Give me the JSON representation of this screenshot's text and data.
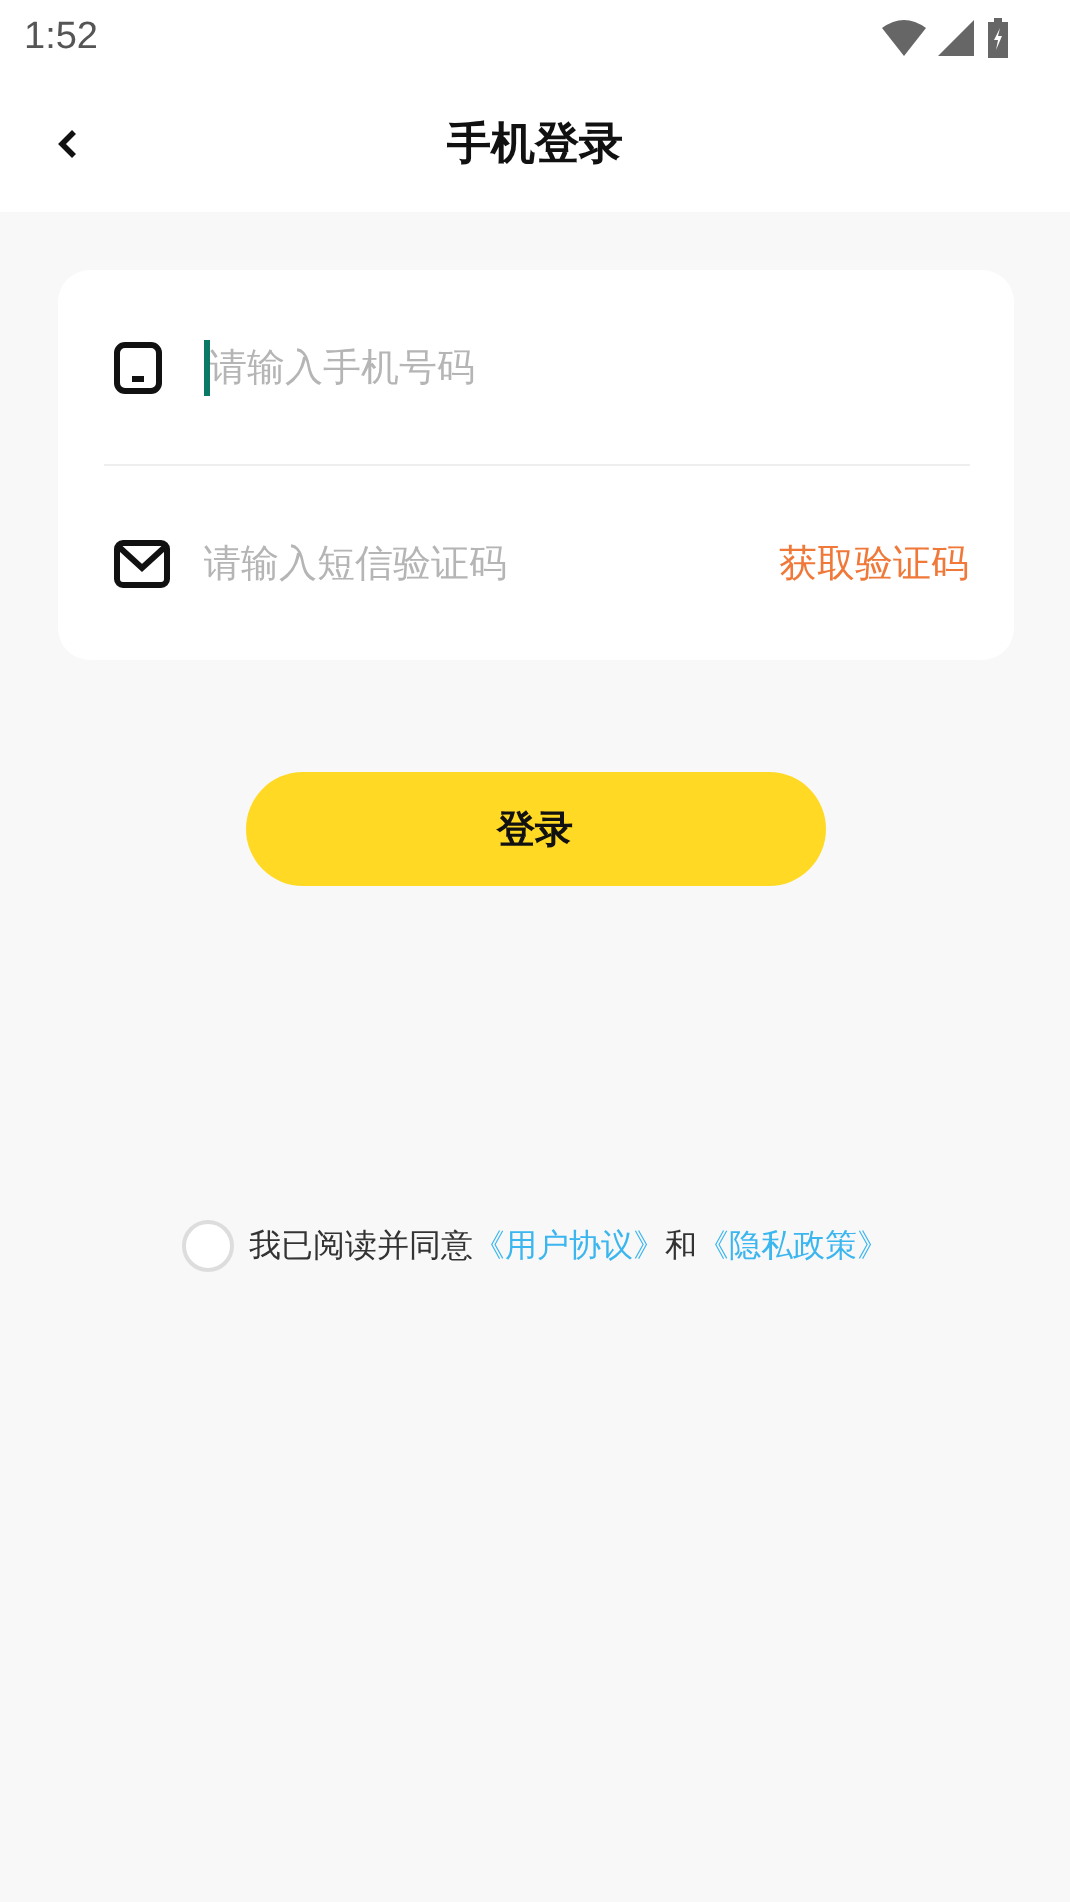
{
  "status_bar": {
    "time": "1:52"
  },
  "header": {
    "title": "手机登录"
  },
  "form": {
    "phone": {
      "placeholder": "请输入手机号码",
      "focused": true
    },
    "code": {
      "placeholder": "请输入短信验证码"
    },
    "get_code": "获取验证码"
  },
  "login_button": "登录",
  "agreement": {
    "checked": false,
    "text": "我已阅读并同意",
    "link_1": "《用户协议》",
    "joiner": "和",
    "link_2": "《隐私政策》"
  }
}
